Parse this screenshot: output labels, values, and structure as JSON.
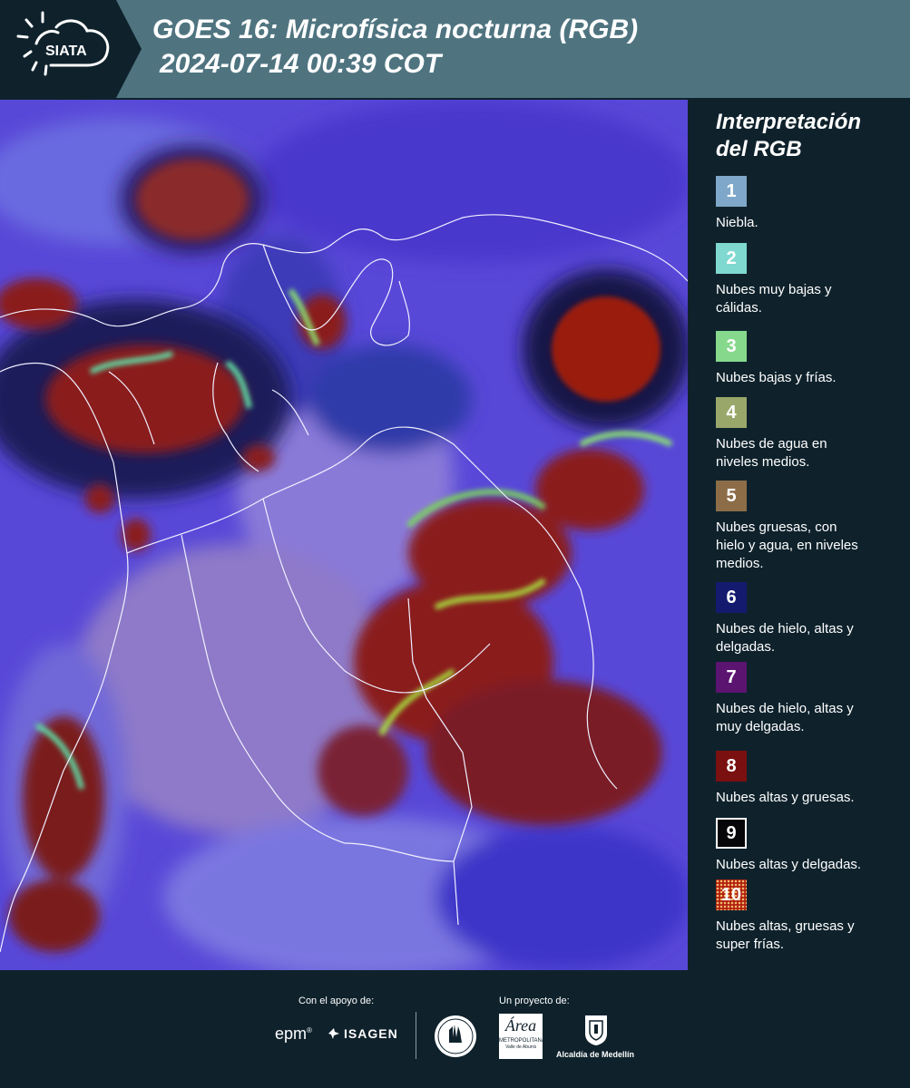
{
  "header": {
    "logo_text": "SIATA",
    "title_line1": "GOES 16: Microfísica nocturna (RGB)",
    "title_line2": "2024-07-14 00:39 COT"
  },
  "legend": {
    "title_line1": "Interpretación",
    "title_line2": "del RGB",
    "items": [
      {
        "num": "1",
        "color": "#7fa7c9",
        "lines": [
          "Niebla."
        ]
      },
      {
        "num": "2",
        "color": "#7fd9d0",
        "lines": [
          "Nubes muy bajas y",
          "cálidas."
        ]
      },
      {
        "num": "3",
        "color": "#86d98c",
        "lines": [
          "Nubes bajas y frías."
        ]
      },
      {
        "num": "4",
        "color": "#9aa76a",
        "lines": [
          "Nubes de agua en",
          "niveles medios."
        ]
      },
      {
        "num": "5",
        "color": "#8c6d48",
        "lines": [
          "Nubes gruesas, con",
          "hielo y agua, en niveles",
          "medios."
        ]
      },
      {
        "num": "6",
        "color": "#141a6e",
        "lines": [
          "Nubes de hielo, altas y",
          "delgadas."
        ]
      },
      {
        "num": "7",
        "color": "#5b1470",
        "lines": [
          "Nubes de hielo, altas y",
          "muy delgadas."
        ]
      },
      {
        "num": "8",
        "color": "#7a1010",
        "lines": [
          "Nubes altas y gruesas."
        ]
      },
      {
        "num": "9",
        "color": "#060608",
        "lines": [
          "Nubes altas y delgadas."
        ]
      },
      {
        "num": "10",
        "color": "#b01e0e",
        "lines": [
          "Nubes altas, gruesas y",
          "super frías."
        ]
      }
    ]
  },
  "footer": {
    "support_label": "Con el apoyo de:",
    "project_label": "Un proyecto de:",
    "epm_logo": "epm",
    "isagen_logo": "ISAGEN",
    "area_logo": "Área",
    "area_sub1": "METROPOLITANA",
    "area_sub2": "Valle de Aburrá",
    "alcaldia_logo": "Alcaldía de Medellín"
  }
}
